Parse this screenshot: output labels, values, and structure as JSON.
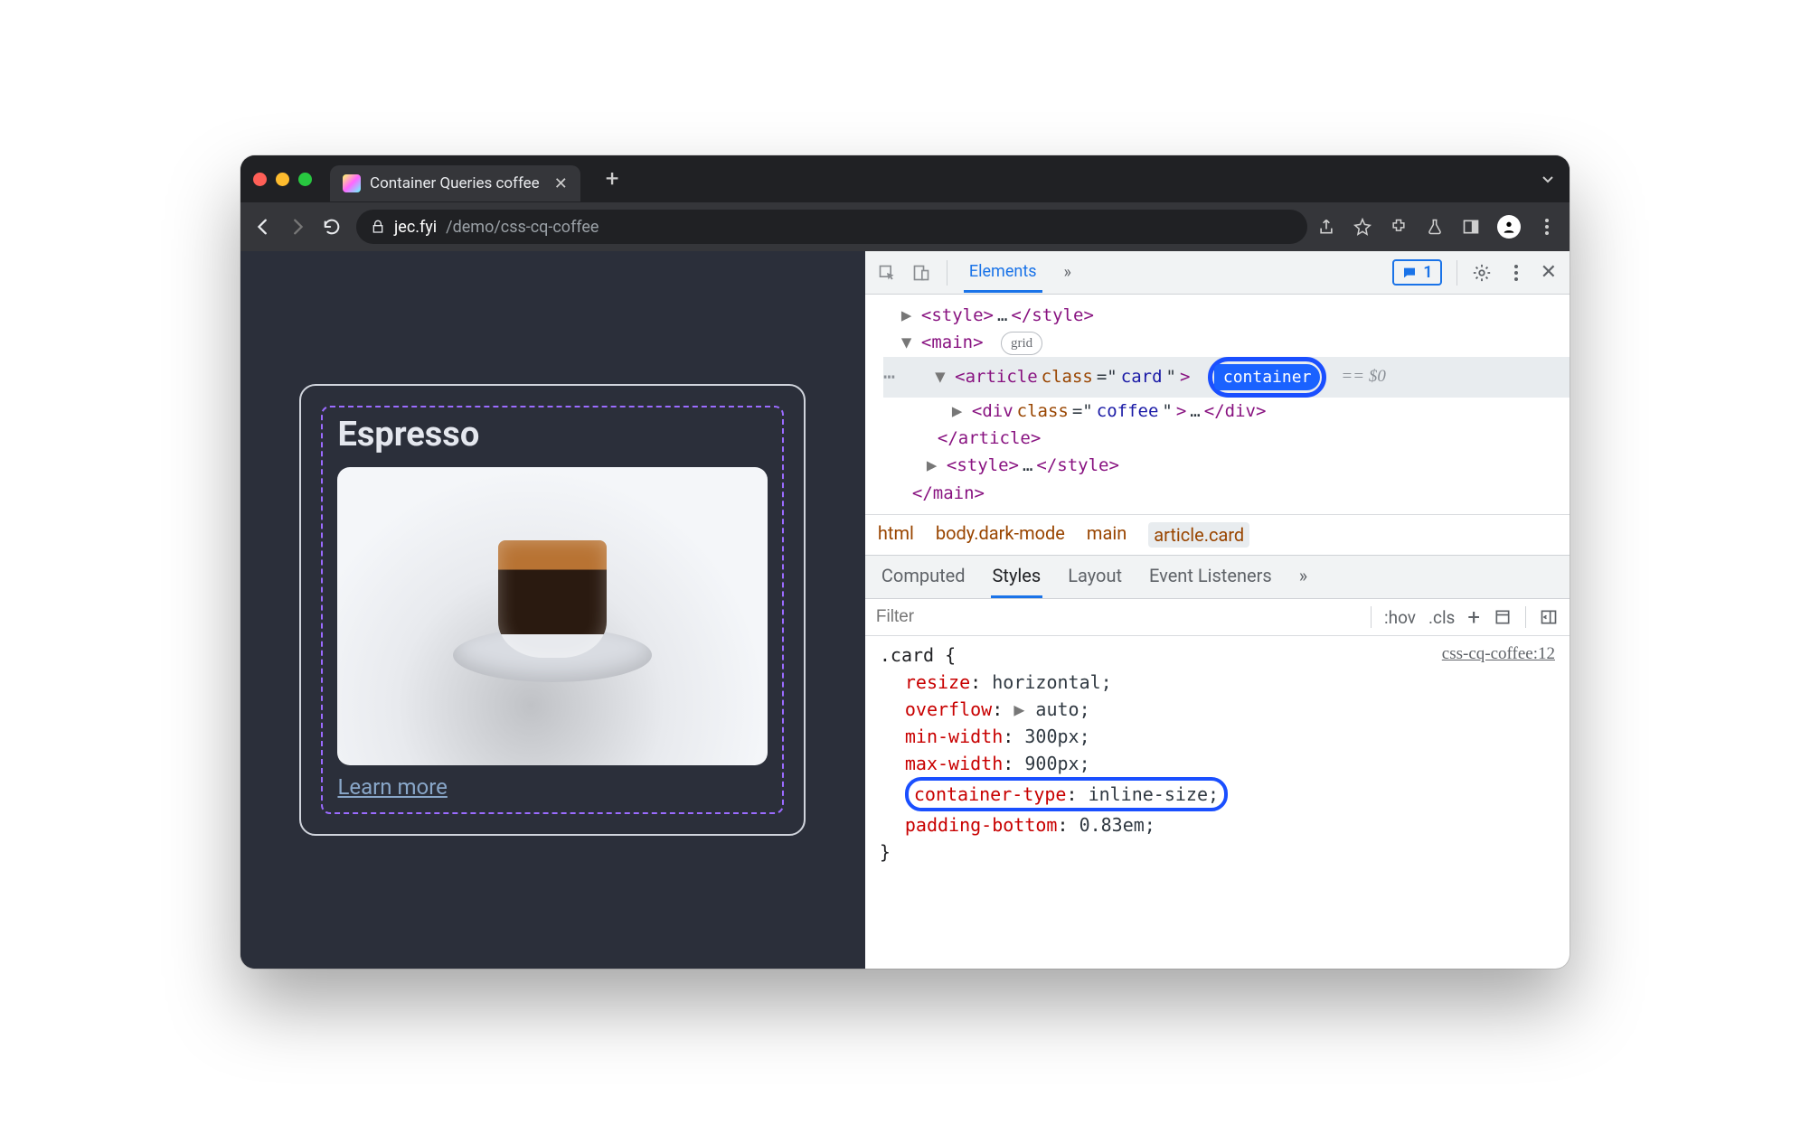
{
  "window": {
    "tab_title": "Container Queries coffee",
    "url_host": "jec.fyi",
    "url_path": "/demo/css-cq-coffee"
  },
  "page": {
    "card_title": "Espresso",
    "learn_more": "Learn more"
  },
  "devtools": {
    "panel_tab": "Elements",
    "more_tabs_glyph": "»",
    "message_count": "1",
    "dom": {
      "style_open": "<style>",
      "style_ellipsis": "…",
      "style_close": "</style>",
      "main_open": "<main>",
      "grid_badge": "grid",
      "article_open_1": "<article ",
      "article_attr_name": "class",
      "article_attr_val": "card",
      "article_open_2": ">",
      "container_badge": "container",
      "eq_zero": "== $0",
      "div_open_1": "<div ",
      "div_attr_name": "class",
      "div_attr_val": "coffee",
      "div_open_2": ">",
      "div_ellipsis": "…",
      "div_close": "</div>",
      "article_close": "</article>",
      "style2_open": "<style>",
      "style2_ellipsis": "…",
      "style2_close": "</style>",
      "main_close": "</main>"
    },
    "breadcrumbs": [
      "html",
      "body.dark-mode",
      "main",
      "article.card"
    ],
    "styles_tabs": [
      "Computed",
      "Styles",
      "Layout",
      "Event Listeners"
    ],
    "styles_more": "»",
    "filter_placeholder": "Filter",
    "filter_tools": {
      "hov": ":hov",
      "cls": ".cls",
      "plus": "+"
    },
    "rule": {
      "selector": ".card",
      "brace_open": "{",
      "source": "css-cq-coffee:12",
      "props": [
        {
          "n": "resize",
          "v": "horizontal;"
        },
        {
          "n": "overflow",
          "v": "auto;",
          "expand": true
        },
        {
          "n": "min-width",
          "v": "300px;"
        },
        {
          "n": "max-width",
          "v": "900px;"
        },
        {
          "n": "container-type",
          "v": "inline-size;",
          "hl": true
        },
        {
          "n": "padding-bottom",
          "v": "0.83em;"
        }
      ],
      "brace_close": "}"
    }
  }
}
